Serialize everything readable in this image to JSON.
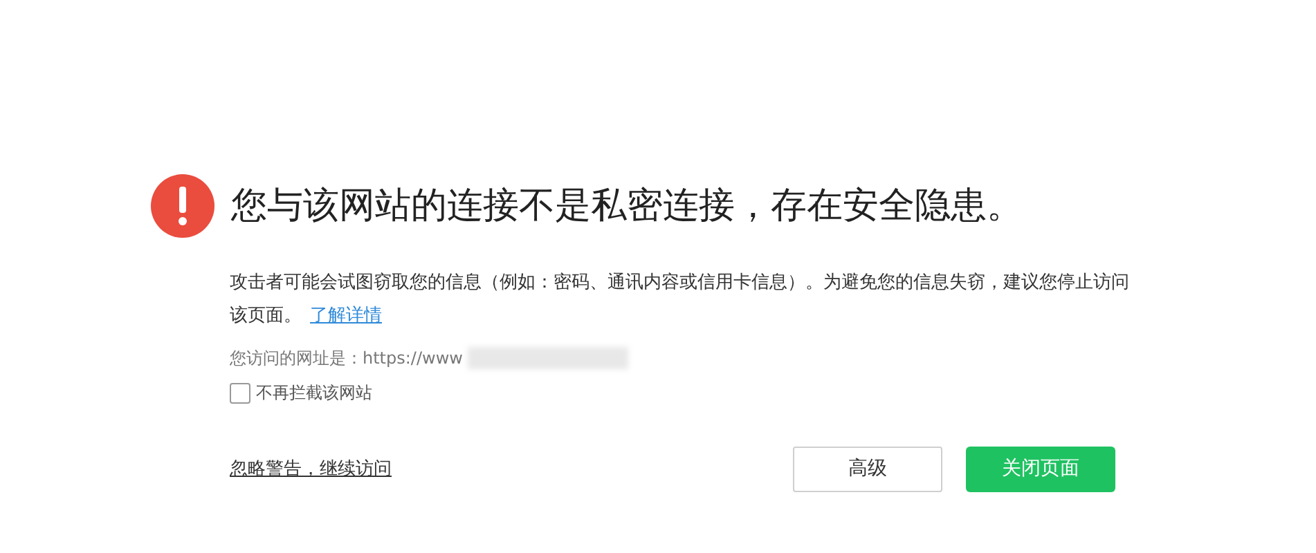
{
  "title": "您与该网站的连接不是私密连接，存在安全隐患。",
  "description": "攻击者可能会试图窃取您的信息（例如：密码、通讯内容或信用卡信息）。为避免您的信息失窃，建议您停止访问该页面。",
  "learn_more_link": "了解详情",
  "url_line": "您访问的网址是：https://www",
  "no_block_checkbox": {
    "label": "不再拦截该网站",
    "checked": false
  },
  "ignore_link": "忽略警告，继续访问",
  "buttons": [
    {
      "label": "高级",
      "kind": "secondary"
    },
    {
      "label": "关闭页面",
      "kind": "primary"
    }
  ]
}
